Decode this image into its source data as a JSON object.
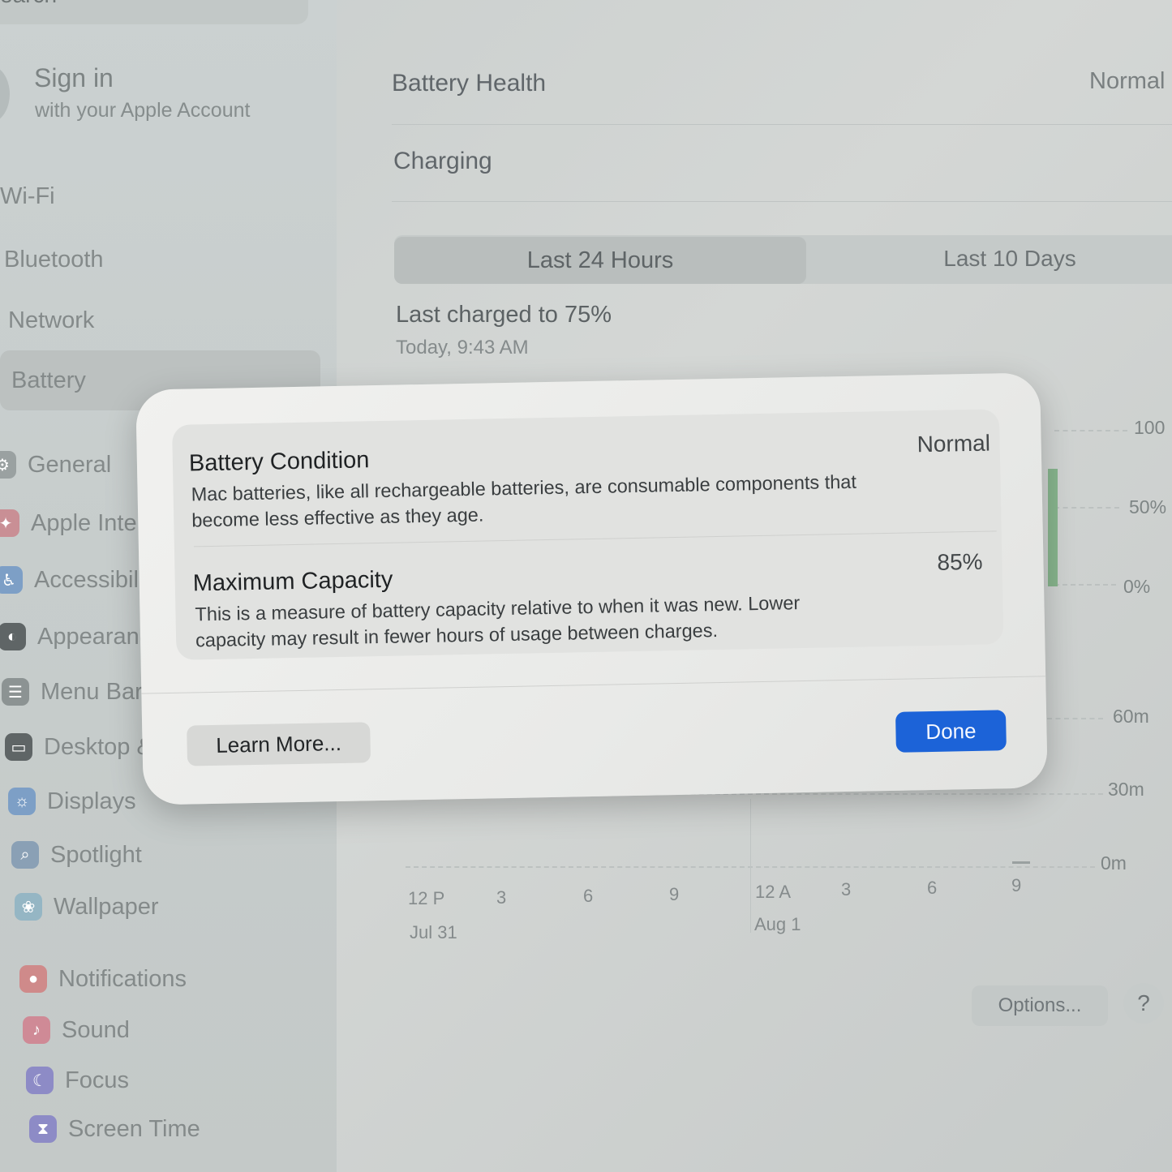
{
  "sidebar": {
    "search_placeholder": "earch",
    "account": {
      "title": "Sign in",
      "subtitle": "with your Apple Account"
    },
    "items": [
      {
        "label": "Wi-Fi",
        "icon": "wifi-icon",
        "color": "#c6cccb"
      },
      {
        "label": "Bluetooth",
        "icon": "bluetooth-icon",
        "color": "#c6cccb"
      },
      {
        "label": "Network",
        "icon": "network-icon",
        "color": "#c6cccb"
      },
      {
        "label": "Battery",
        "icon": "battery-icon",
        "color": "#c6cccb",
        "selected": true
      },
      {
        "label": "General",
        "icon": "gear-icon",
        "color": "#9aa1a1"
      },
      {
        "label": "Apple Inte",
        "icon": "apple-intelligence-icon",
        "color": "#c98f95"
      },
      {
        "label": "Accessibil",
        "icon": "accessibility-icon",
        "color": "#7d9fc6"
      },
      {
        "label": "Appearanc",
        "icon": "appearance-icon",
        "color": "#5f6566"
      },
      {
        "label": "Menu Bar",
        "icon": "menu-bar-icon",
        "color": "#8c9393"
      },
      {
        "label": "Desktop &",
        "icon": "desktop-icon",
        "color": "#5f6566"
      },
      {
        "label": "Displays",
        "icon": "displays-icon",
        "color": "#7d9fc6"
      },
      {
        "label": "Spotlight",
        "icon": "spotlight-icon",
        "color": "#8aa0b5"
      },
      {
        "label": "Wallpaper",
        "icon": "wallpaper-icon",
        "color": "#95b6c4"
      },
      {
        "label": "Notifications",
        "icon": "notifications-icon",
        "color": "#cf8a8a"
      },
      {
        "label": "Sound",
        "icon": "sound-icon",
        "color": "#cf8a96"
      },
      {
        "label": "Focus",
        "icon": "focus-icon",
        "color": "#8d8bc6"
      },
      {
        "label": "Screen Time",
        "icon": "screen-time-icon",
        "color": "#8d8bc6"
      }
    ]
  },
  "main": {
    "battery_health": {
      "label": "Battery Health",
      "value": "Normal"
    },
    "charging": {
      "label": "Charging"
    },
    "tabs": [
      {
        "label": "Last 24 Hours",
        "selected": true
      },
      {
        "label": "Last 10 Days",
        "selected": false
      }
    ],
    "last_charged": {
      "title": "Last charged to 75%",
      "time": "Today, 9:43 AM"
    },
    "level_axis": [
      "100",
      "50%",
      "0%"
    ],
    "usage_axis": [
      "60m",
      "30m",
      "0m"
    ],
    "x_ticks": [
      "12 P",
      "3",
      "6",
      "9",
      "12 A",
      "3",
      "6",
      "9"
    ],
    "dates": [
      "Jul 31",
      "Aug 1"
    ],
    "options_label": "Options...",
    "help_label": "?"
  },
  "dialog": {
    "condition": {
      "title": "Battery Condition",
      "description": "Mac batteries, like all rechargeable batteries, are consumable components that become less effective as they age.",
      "value": "Normal"
    },
    "capacity": {
      "title": "Maximum Capacity",
      "description": "This is a measure of battery capacity relative to when it was new. Lower capacity may result in fewer hours of usage between charges.",
      "value": "85%"
    },
    "learn_more_label": "Learn More...",
    "done_label": "Done",
    "accent_color": "#1c63d8"
  }
}
